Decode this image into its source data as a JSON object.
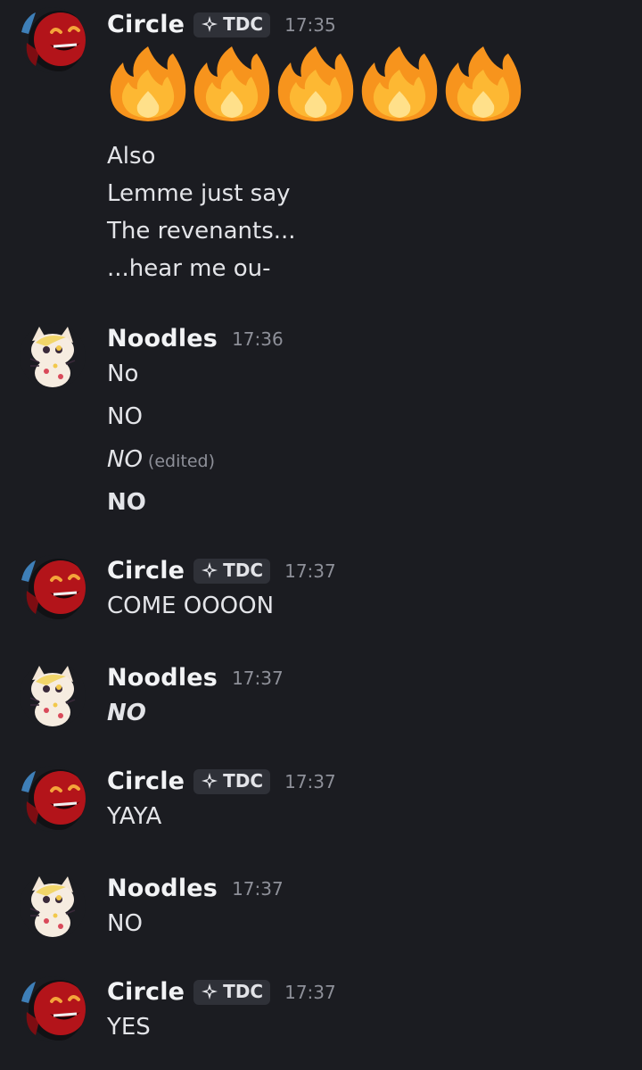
{
  "users": {
    "circle": {
      "name": "Circle",
      "tag": "TDC",
      "tag_icon": "sparkle-diamond-icon"
    },
    "noodles": {
      "name": "Noodles"
    }
  },
  "messages": [
    {
      "author": "Circle",
      "tag": "TDC",
      "time": "17:35",
      "emojis": [
        "fire-emoji",
        "fire-emoji",
        "fire-emoji",
        "fire-emoji",
        "fire-emoji"
      ],
      "lines": [
        "Also",
        "Lemme just say",
        "The revenants...",
        "...hear me ou-"
      ]
    },
    {
      "author": "Noodles",
      "time": "17:36",
      "lines": [
        "No",
        "NO",
        "NO",
        "NO"
      ],
      "edited_label": "(edited)"
    },
    {
      "author": "Circle",
      "tag": "TDC",
      "time": "17:37",
      "lines": [
        "COME OOOON"
      ]
    },
    {
      "author": "Noodles",
      "time": "17:37",
      "lines": [
        "NO"
      ]
    },
    {
      "author": "Circle",
      "tag": "TDC",
      "time": "17:37",
      "lines": [
        "YAYA"
      ]
    },
    {
      "author": "Noodles",
      "time": "17:37",
      "lines": [
        "NO"
      ]
    },
    {
      "author": "Circle",
      "tag": "TDC",
      "time": "17:37",
      "lines": [
        "YES"
      ]
    }
  ],
  "colors": {
    "background": "#1b1c21",
    "text": "#e3e4e8",
    "muted": "#8e9099",
    "tag_bg": "#2f3138",
    "circle_red": "#b3141a"
  }
}
